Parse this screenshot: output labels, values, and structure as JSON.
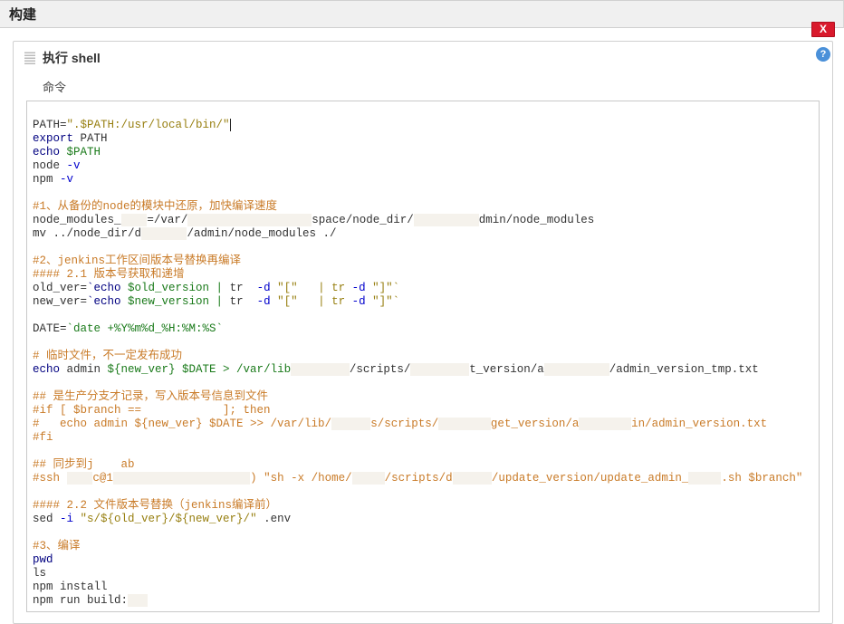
{
  "section": {
    "title": "构建"
  },
  "buildStep": {
    "title": "执行 shell",
    "fieldLabel": "命令",
    "closeLabel": "X",
    "helpLabel": "?"
  },
  "code": {
    "l01a": "PATH=",
    "l01b": "\".$PATH:/usr/local/bin/\"",
    "l02a": "export",
    "l02b": " PATH",
    "l03a": "echo",
    "l03b": " $PATH",
    "l04a": "node ",
    "l04b": "-v",
    "l05a": "npm ",
    "l05b": "-v",
    "l06": "#1、从备份的node的模块中还原，加快编译速度",
    "l07a": "node_modules_",
    "l07b": "=/var/",
    "l07c": "space/node_dir/",
    "l07d": "dmin/node_modules",
    "l08a": "mv ../node_dir/d",
    "l08b": "/admin/node_modules ./",
    "l09": "#2、jenkins工作区间版本号替换再编译",
    "l10": "#### 2.1 版本号获取和递增",
    "l11a": "old_ver=",
    "l11b": "`echo",
    "l11c": " $old_version | ",
    "l11d": "tr  ",
    "l11e": "-d",
    "l11f": " \"[\"   | tr ",
    "l11g": "-d",
    "l11h": " \"]\"`",
    "l12a": "new_ver=",
    "l12b": "`echo",
    "l12c": " $new_version | ",
    "l13a": "DATE=",
    "l13b": "`date +%Y%m%d_%H:%M:%S`",
    "l14": "# 临时文件，不一定发布成功",
    "l15a": "echo",
    "l15b": " admin ",
    "l15c": "${new_ver}",
    "l15d": " $DATE > /var/lib",
    "l15e": "/scripts/",
    "l15f": "t_version/a",
    "l15g": "/admin_version_tmp.txt",
    "l16": "## 是生产分支才记录，写入版本号信息到文件",
    "l17": "#if [ $branch ==            ]; then",
    "l18a": "#   echo admin ${new_ver} $DATE >> /var/lib/",
    "l18b": "s/scripts/",
    "l18c": "get_version/a",
    "l18d": "in/admin_version.txt",
    "l19": "#fi",
    "l20": "## 同步到j    ab",
    "l21a": "#ssh ",
    "l21b": "c@1",
    "l21c": ") \"sh -x /home/",
    "l21d": "/scripts/d",
    "l21e": "/update_version/update_admin_",
    "l21f": ".sh $branch\"",
    "l22": "#### 2.2 文件版本号替换（jenkins编译前）",
    "l23a": "sed ",
    "l23b": "-i",
    "l23c": " \"s/${old_ver}/${new_ver}/\"",
    "l23d": " .env",
    "l24": "#3、编译",
    "l25": "pwd",
    "l26": "ls",
    "l27": "npm install",
    "l28": "npm run build:"
  }
}
